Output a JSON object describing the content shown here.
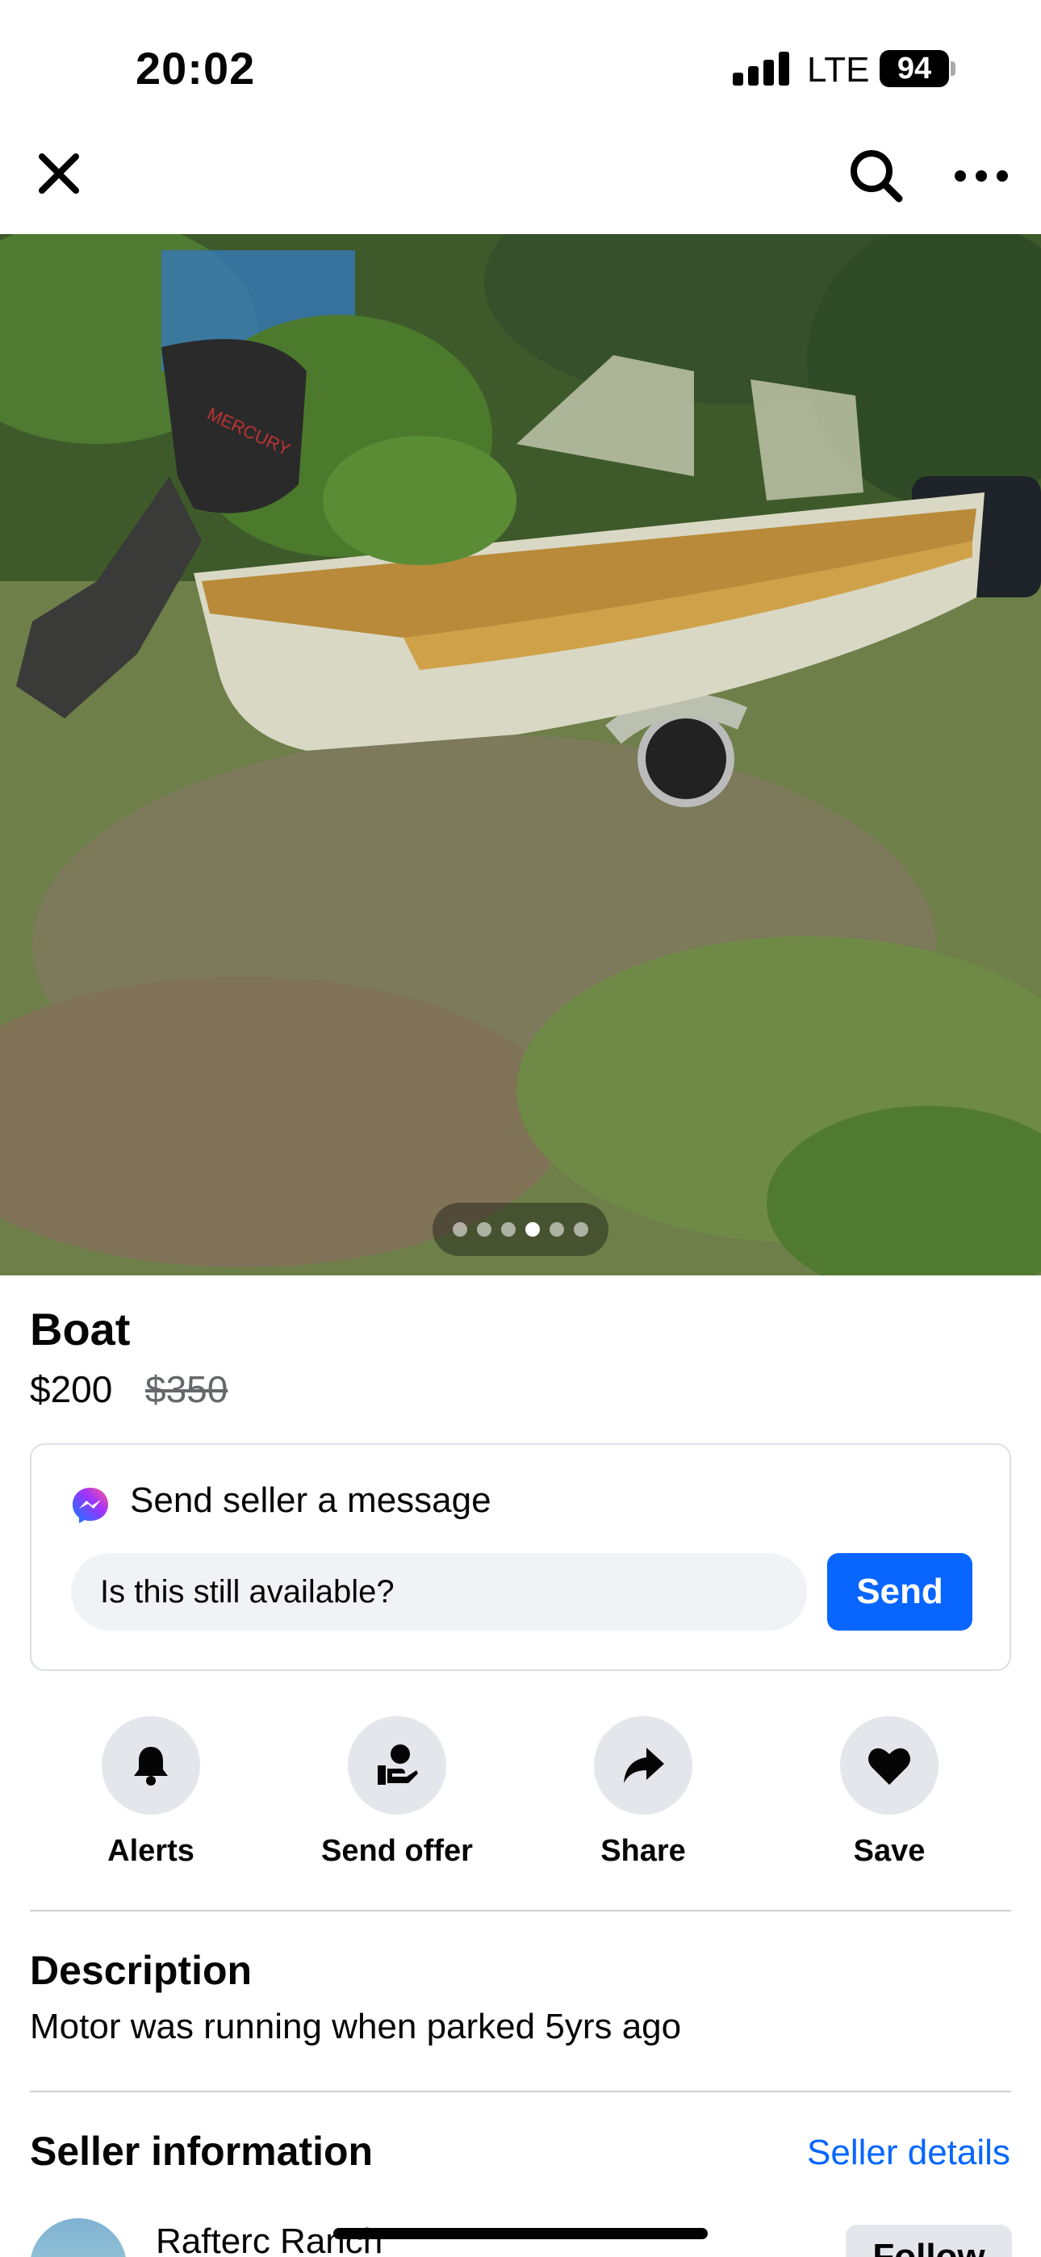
{
  "status_bar": {
    "time": "20:02",
    "network": "LTE",
    "battery": "94"
  },
  "nav": {
    "close_icon": "close-icon",
    "search_icon": "search-icon",
    "more_icon": "more-icon"
  },
  "photo": {
    "description_icon": "boat-photo",
    "page_count": 6,
    "active_page": 4
  },
  "listing": {
    "title": "Boat",
    "price": "$200",
    "original_price": "$350"
  },
  "message": {
    "label": "Send seller a message",
    "input_value": "Is this still available?",
    "send_label": "Send"
  },
  "actions": [
    {
      "label": "Alerts",
      "icon": "bell-icon"
    },
    {
      "label": "Send offer",
      "icon": "offer-icon"
    },
    {
      "label": "Share",
      "icon": "share-icon"
    },
    {
      "label": "Save",
      "icon": "heart-icon"
    }
  ],
  "description": {
    "heading": "Description",
    "text": "Motor was running when parked 5yrs ago"
  },
  "seller": {
    "heading": "Seller information",
    "details_link": "Seller details",
    "name": "Rafterc Ranch",
    "follow_label": "Follow"
  },
  "colors": {
    "accent": "#0866ff",
    "button_gray": "#e4e6eb"
  }
}
